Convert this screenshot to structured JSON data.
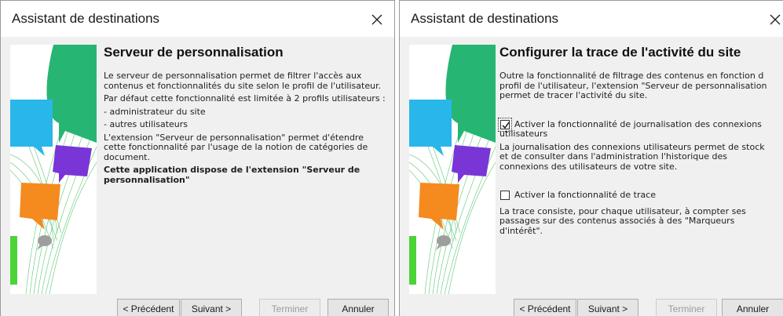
{
  "left_dialog": {
    "title": "Assistant de destinations",
    "heading": "Serveur de personnalisation",
    "paragraphs": [
      "Le serveur de personnalisation permet de filtrer l'accès aux contenus et fonctionnalités du site selon le profil de l'utilisateur.",
      "Par défaut cette fonctionnalité est limitée à 2 profils utilisateurs :",
      "- administrateur du site",
      "- autres utilisateurs",
      "L'extension \"Serveur de personnalisation\" permet d'étendre cette fonctionnalité par l'usage de la notion de catégories de document."
    ],
    "bold_note": "Cette application dispose de l'extension \"Serveur de personnalisation\"",
    "buttons": {
      "previous": "< Précédent",
      "next": "Suivant >",
      "finish": "Terminer",
      "cancel": "Annuler"
    }
  },
  "right_dialog": {
    "title": "Assistant de destinations",
    "heading": "Configurer la trace de l'activité du site",
    "intro_lines": [
      "Outre la fonctionnalité de filtrage des contenus en fonction d",
      "profil de l'utilisateur, l'extension \"Serveur de personnalisation",
      "permet de tracer l'activité du site."
    ],
    "option1": {
      "label_line1": "Activer la fonctionnalité de journalisation des connexions",
      "label_line2": "utilisateurs",
      "checked": true,
      "desc_lines": [
        "La journalisation des connexions utilisateurs permet de stock",
        "et de consulter dans l'administration l'historique des",
        "connexions des utilisateurs de votre site."
      ]
    },
    "option2": {
      "label": "Activer la fonctionnalité de trace",
      "checked": false,
      "desc_lines": [
        "La trace consiste, pour chaque utilisateur, à compter ses",
        "passages sur des contenus associés à des \"Marqueurs",
        "d'intérêt\"."
      ]
    },
    "buttons": {
      "previous": "< Précédent",
      "next": "Suivant >",
      "finish": "Terminer",
      "cancel": "Annuler"
    }
  },
  "colors": {
    "green": "#27b573",
    "blue": "#29b6e8",
    "purple": "#7a35d6",
    "orange": "#f58a1f",
    "lime": "#4cd437",
    "gray_bubble": "#9e9e9e"
  },
  "icons": {
    "close": "close-icon",
    "checkmark": "check-icon",
    "sidebar": "speech-bubbles-illustration"
  }
}
